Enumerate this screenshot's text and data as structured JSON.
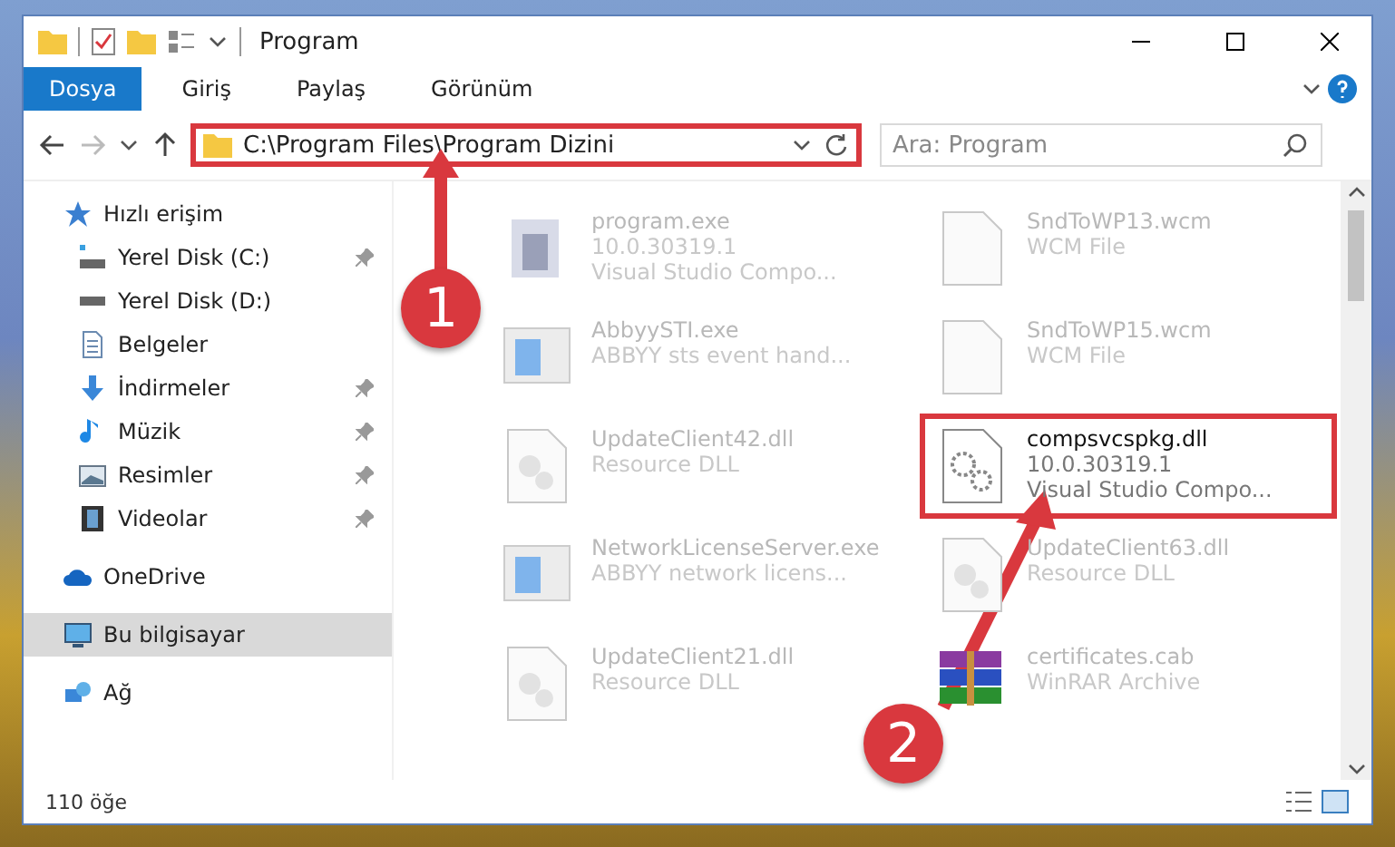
{
  "window": {
    "title": "Program"
  },
  "ribbon": {
    "tabs": [
      {
        "label": "Dosya",
        "selected": true
      },
      {
        "label": "Giriş",
        "selected": false
      },
      {
        "label": "Paylaş",
        "selected": false
      },
      {
        "label": "Görünüm",
        "selected": false
      }
    ]
  },
  "navigation": {
    "address": "C:\\Program Files\\Program Dizini",
    "address_highlighted": true,
    "search": {
      "placeholder": "Ara: Program"
    }
  },
  "sidebar": {
    "items": [
      {
        "label": "Hızlı erişim",
        "kind": "star",
        "selected": false,
        "children": [
          {
            "label": "Yerel Disk (C:)",
            "kind": "drive-c",
            "pinned": true,
            "selected": false
          },
          {
            "label": "Yerel Disk (D:)",
            "kind": "drive",
            "pinned": false,
            "selected": false
          },
          {
            "label": "Belgeler",
            "kind": "document",
            "pinned": false,
            "selected": false
          },
          {
            "label": "İndirmeler",
            "kind": "download",
            "pinned": true,
            "selected": false
          },
          {
            "label": "Müzik",
            "kind": "music",
            "pinned": true,
            "selected": false
          },
          {
            "label": "Resimler",
            "kind": "picture",
            "pinned": true,
            "selected": false
          },
          {
            "label": "Videolar",
            "kind": "video",
            "pinned": true,
            "selected": false
          }
        ]
      },
      {
        "label": "OneDrive",
        "kind": "cloud",
        "selected": false
      },
      {
        "label": "Bu bilgisayar",
        "kind": "computer",
        "selected": true
      },
      {
        "label": "Ağ",
        "kind": "network",
        "selected": false
      }
    ]
  },
  "files": [
    {
      "name": "program.exe",
      "details": [
        "10.0.30319.1",
        "Visual Studio Compo..."
      ],
      "kind": "installer",
      "highlighted": false
    },
    {
      "name": "SndToWP13.wcm",
      "details": [
        "WCM File"
      ],
      "kind": "blank",
      "highlighted": false
    },
    {
      "name": "AbbyySTI.exe",
      "details": [
        "ABBYY sts event hand..."
      ],
      "kind": "app",
      "highlighted": false
    },
    {
      "name": "SndToWP15.wcm",
      "details": [
        "WCM File"
      ],
      "kind": "blank",
      "highlighted": false
    },
    {
      "name": "UpdateClient42.dll",
      "details": [
        "Resource DLL"
      ],
      "kind": "dll",
      "highlighted": false
    },
    {
      "name": "compsvcspkg.dll",
      "details": [
        "10.0.30319.1",
        "Visual Studio Compo..."
      ],
      "kind": "gears",
      "highlighted": true
    },
    {
      "name": "NetworkLicenseServer.exe",
      "details": [
        "ABBYY network licens..."
      ],
      "kind": "app",
      "highlighted": false
    },
    {
      "name": "UpdateClient63.dll",
      "details": [
        "Resource DLL"
      ],
      "kind": "dll",
      "highlighted": false
    },
    {
      "name": "UpdateClient21.dll",
      "details": [
        "Resource DLL"
      ],
      "kind": "dll",
      "highlighted": false
    },
    {
      "name": "certificates.cab",
      "details": [
        "WinRAR Archive"
      ],
      "kind": "archive",
      "highlighted": false
    }
  ],
  "status_bar": {
    "item_count": "110 öğe"
  },
  "callouts": [
    {
      "number": "1"
    },
    {
      "number": "2"
    }
  ]
}
